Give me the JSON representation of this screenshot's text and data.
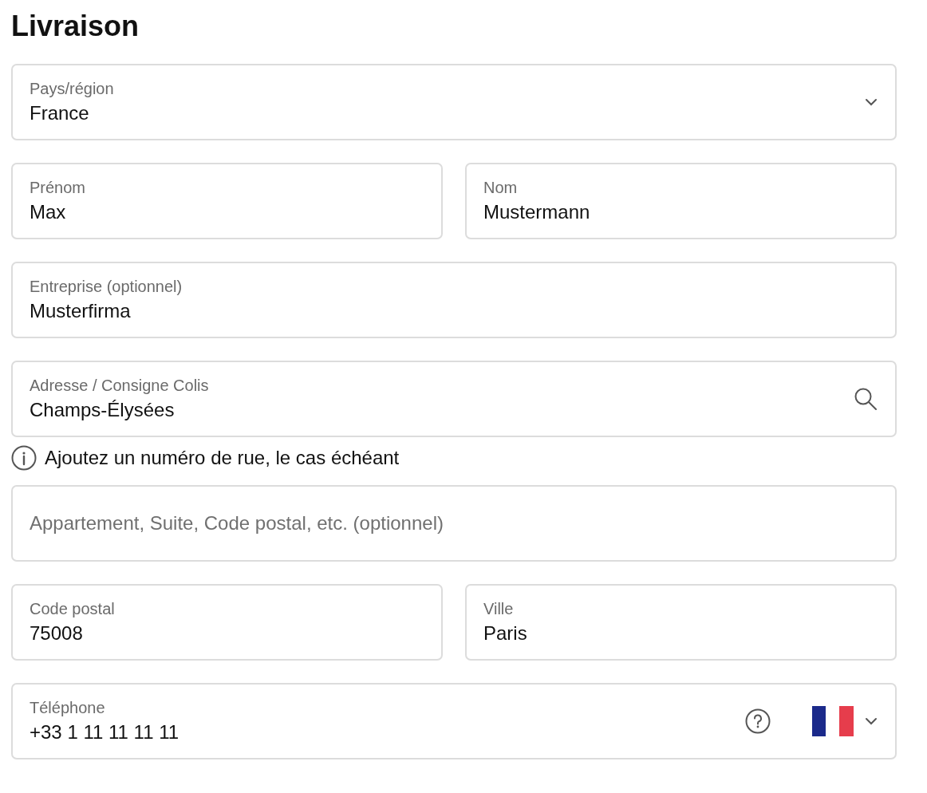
{
  "title": "Livraison",
  "rows": [
    {
      "kind": "fields",
      "fields": [
        {
          "kind": "select",
          "label": "Pays/région",
          "value": "France"
        }
      ]
    },
    {
      "kind": "fields",
      "fields": [
        {
          "kind": "text",
          "label": "Prénom",
          "value": "Max"
        },
        {
          "kind": "text",
          "label": "Nom",
          "value": "Mustermann"
        }
      ]
    },
    {
      "kind": "fields",
      "fields": [
        {
          "kind": "text",
          "label": "Entreprise (optionnel)",
          "value": "Musterfirma"
        }
      ]
    },
    {
      "kind": "fields",
      "fields": [
        {
          "kind": "search",
          "label": "Adresse / Consigne Colis",
          "value": "Champs-Élysées"
        }
      ]
    },
    {
      "kind": "hint",
      "text": "Ajoutez un numéro de rue, le cas échéant"
    },
    {
      "kind": "fields",
      "fields": [
        {
          "kind": "empty",
          "placeholder": "Appartement, Suite, Code postal, etc. (optionnel)"
        }
      ]
    },
    {
      "kind": "fields",
      "fields": [
        {
          "kind": "text",
          "label": "Code postal",
          "value": "75008"
        },
        {
          "kind": "text",
          "label": "Ville",
          "value": "Paris"
        }
      ]
    },
    {
      "kind": "fields",
      "fields": [
        {
          "kind": "phone",
          "label": "Téléphone",
          "value": "+33 1 11 11 11 11"
        }
      ]
    }
  ]
}
